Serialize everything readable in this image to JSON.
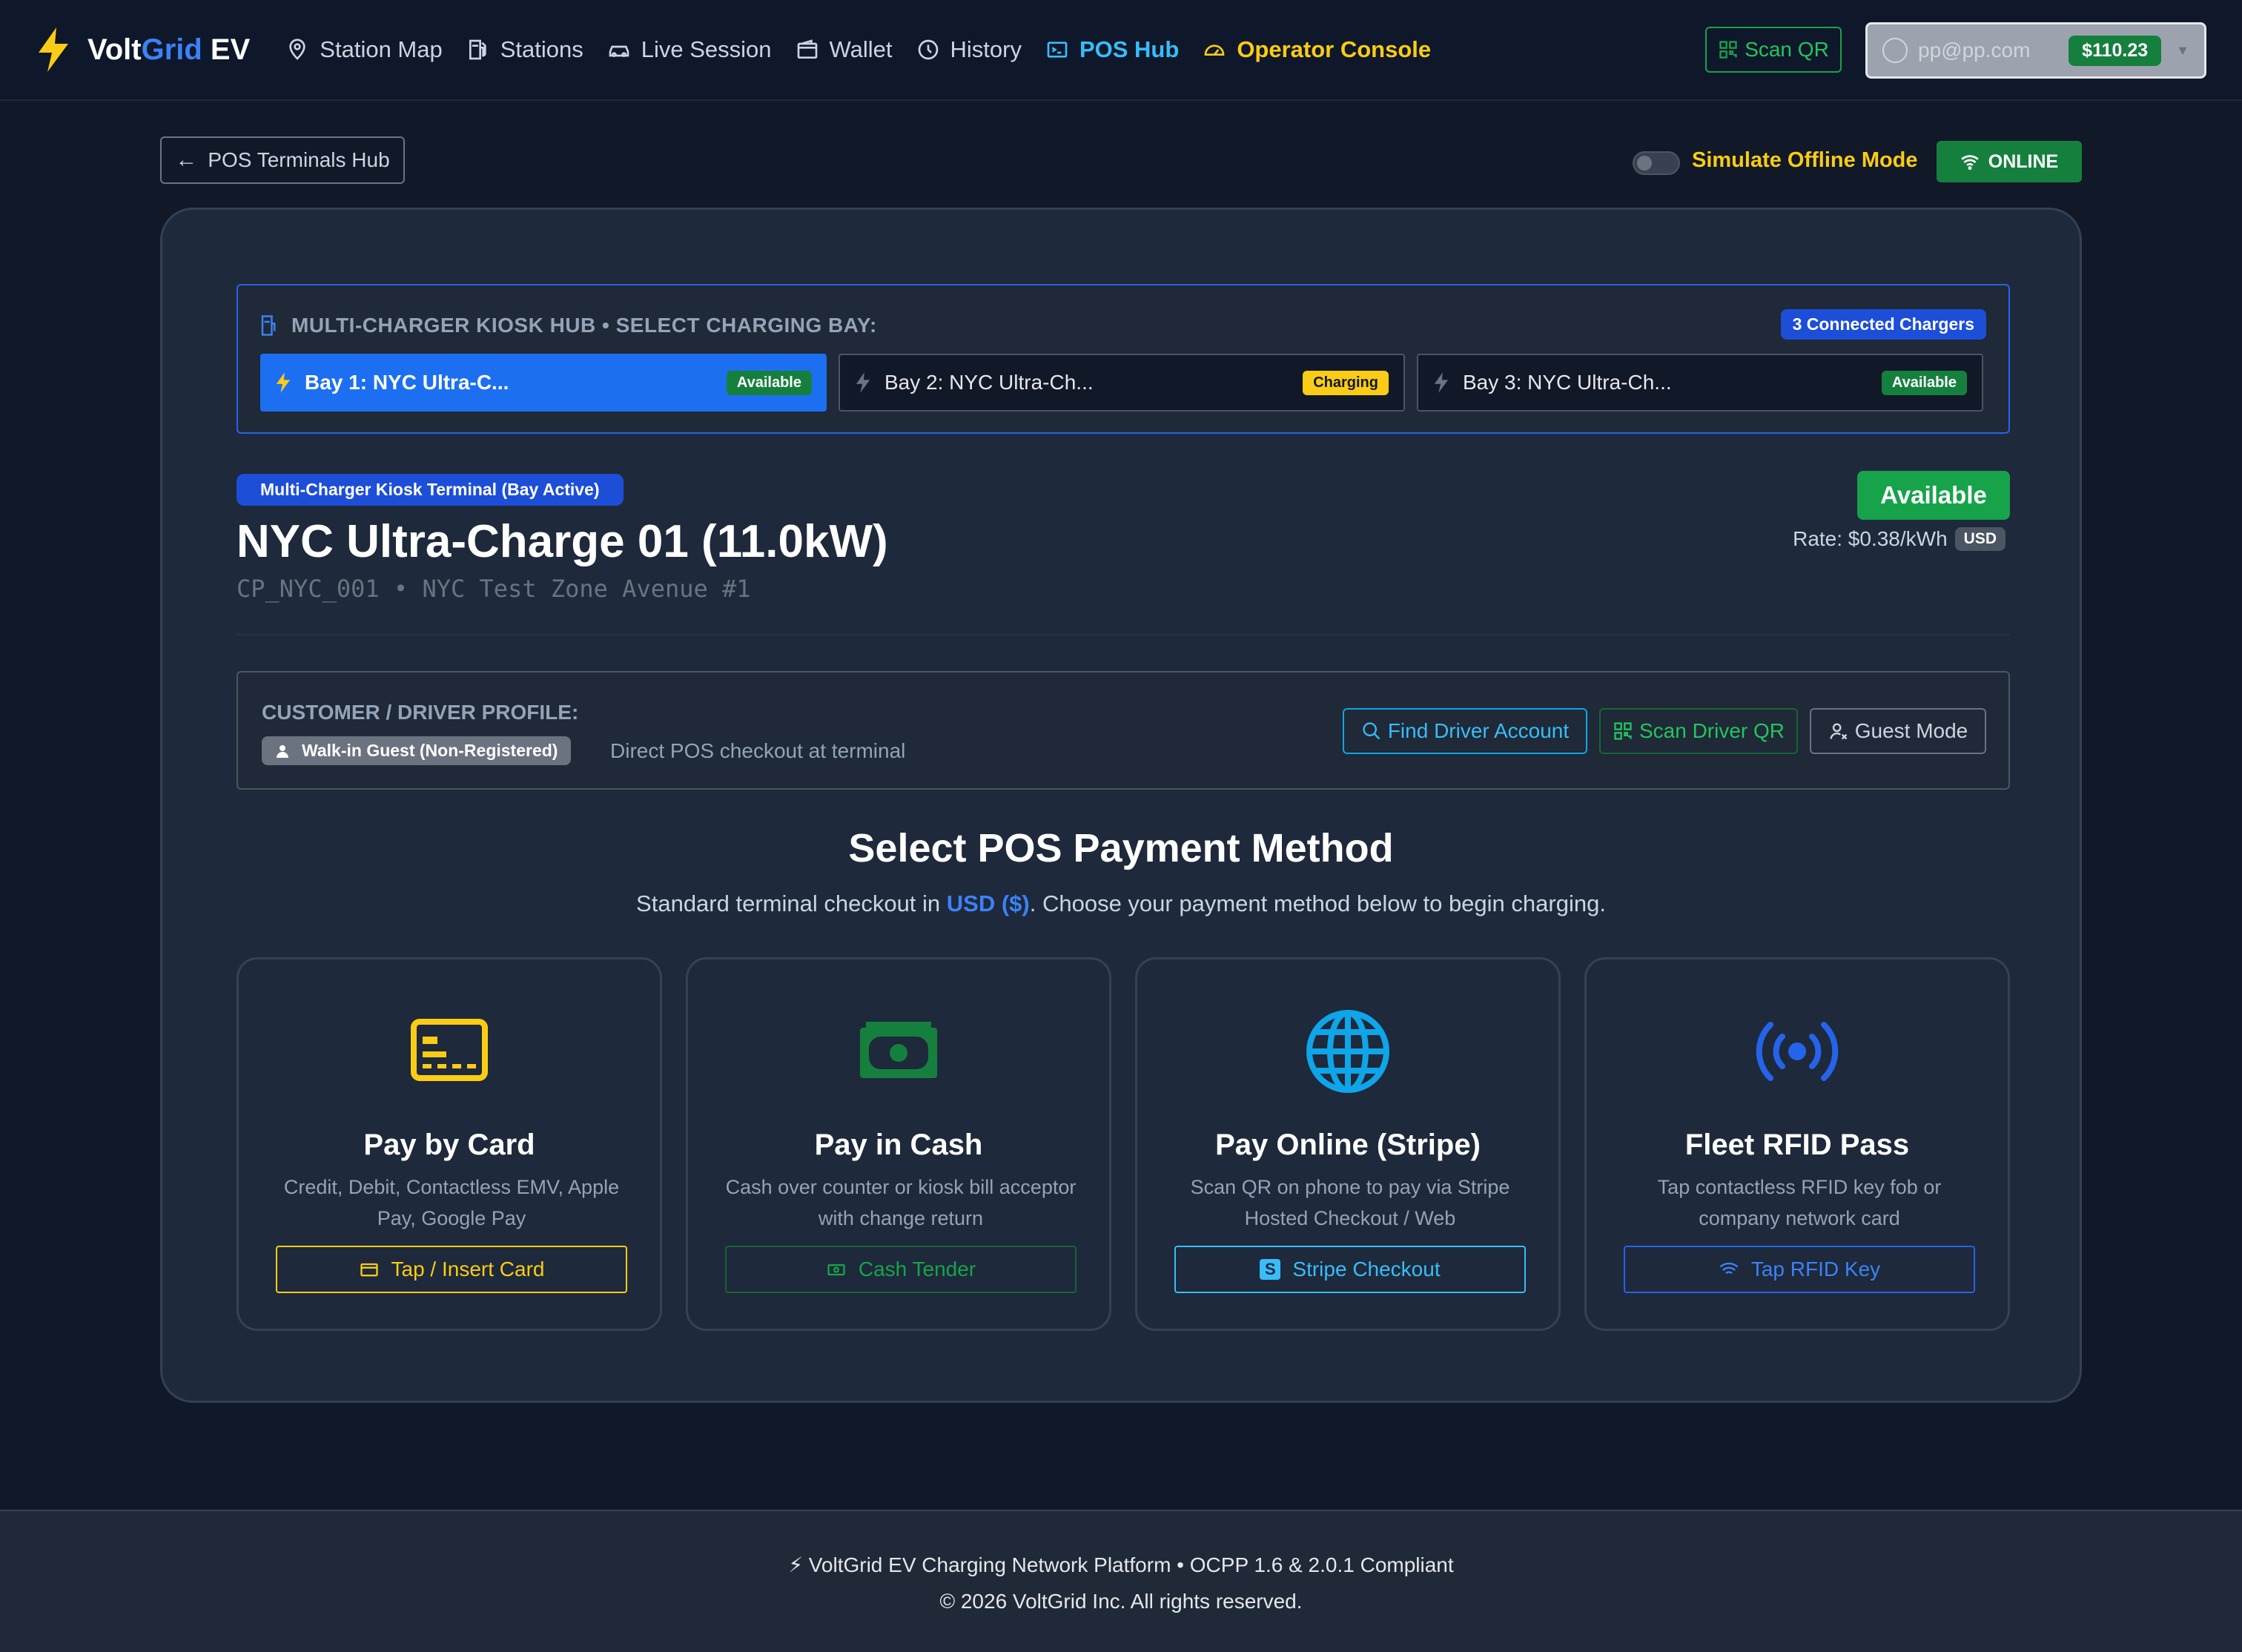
{
  "brand": {
    "name_prefix": "Volt",
    "name_accent": "Grid",
    "name_suffix": " EV"
  },
  "nav": {
    "items": [
      {
        "label": "Station Map",
        "icon": "map-pin-icon"
      },
      {
        "label": "Stations",
        "icon": "fuel-station-icon"
      },
      {
        "label": "Live Session",
        "icon": "car-icon"
      },
      {
        "label": "Wallet",
        "icon": "wallet-icon"
      },
      {
        "label": "History",
        "icon": "clock-icon"
      },
      {
        "label": "POS Hub",
        "icon": "terminal-icon",
        "active": true
      },
      {
        "label": "Operator Console",
        "icon": "gauge-icon"
      }
    ],
    "scan_qr": "Scan QR",
    "account_email": "pp@pp.com",
    "balance": "$110.23"
  },
  "subheader": {
    "back_label": "POS Terminals Hub",
    "offline_label": "Simulate Offline Mode",
    "online_status": "ONLINE"
  },
  "kiosk": {
    "title": "MULTI-CHARGER KIOSK HUB • SELECT CHARGING BAY:",
    "connected": "3 Connected Chargers",
    "bays": [
      {
        "label": "Bay 1: NYC Ultra-C...",
        "status": "Available",
        "active": true
      },
      {
        "label": "Bay 2: NYC Ultra-Ch...",
        "status": "Charging",
        "active": false
      },
      {
        "label": "Bay 3: NYC Ultra-Ch...",
        "status": "Available",
        "active": false
      }
    ]
  },
  "station": {
    "mode_badge": "Multi-Charger Kiosk Terminal (Bay Active)",
    "name": "NYC Ultra-Charge 01 (11.0kW)",
    "subtitle": "CP_NYC_001 • NYC Test Zone Avenue #1",
    "status": "Available",
    "rate": "Rate: $0.38/kWh",
    "currency": "USD"
  },
  "profile": {
    "title": "CUSTOMER / DRIVER PROFILE:",
    "guest_badge": "Walk-in Guest (Non-Registered)",
    "description": "Direct POS checkout at terminal",
    "find_label": "Find Driver Account",
    "scan_label": "Scan Driver QR",
    "guest_label": "Guest Mode"
  },
  "payment": {
    "heading": "Select POS Payment Method",
    "sub_before": "Standard terminal checkout in ",
    "sub_currency": "USD ($)",
    "sub_after": ". Choose your payment method below to begin charging.",
    "methods": [
      {
        "title": "Pay by Card",
        "desc": "Credit, Debit, Contactless EMV, Apple Pay, Google Pay",
        "action": "Tap / Insert Card",
        "icon": "credit-card-icon",
        "color": "#facc15"
      },
      {
        "title": "Pay in Cash",
        "desc": "Cash over counter or kiosk bill acceptor with change return",
        "action": "Cash Tender",
        "icon": "cash-icon",
        "color": "#16a34a"
      },
      {
        "title": "Pay Online (Stripe)",
        "desc": "Scan QR on phone to pay via Stripe Hosted Checkout / Web",
        "action": "Stripe Checkout",
        "icon": "globe-icon",
        "color": "#0ea5e9"
      },
      {
        "title": "Fleet RFID Pass",
        "desc": "Tap contactless RFID key fob or company network card",
        "action": "Tap RFID Key",
        "icon": "rfid-broadcast-icon",
        "color": "#2563eb"
      }
    ]
  },
  "footer": {
    "line1": "⚡ VoltGrid EV Charging Network Platform • OCPP 1.6 & 2.0.1 Compliant",
    "line2": "© 2026 VoltGrid Inc. All rights reserved."
  }
}
